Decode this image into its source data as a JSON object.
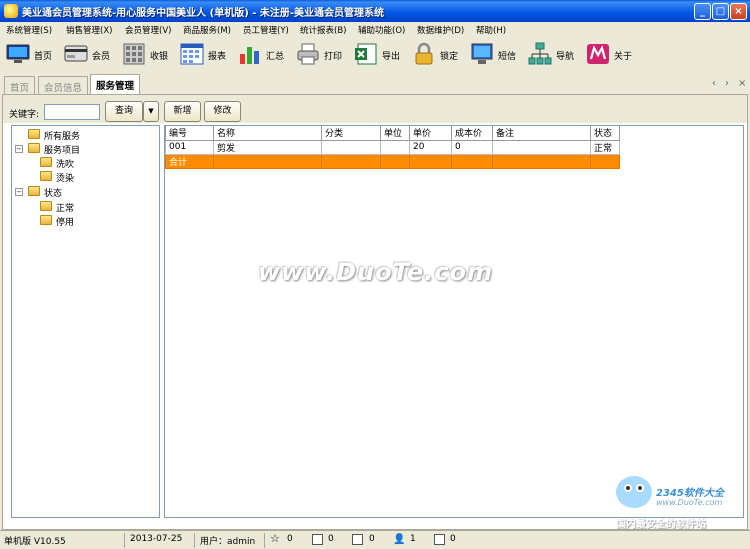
{
  "window": {
    "title": "美业通会员管理系统-用心服务中国美业人 (单机版) - 未注册-美业通会员管理系统"
  },
  "menu": [
    "系统管理(S)",
    "销售管理(X)",
    "会员管理(V)",
    "商品服务(M)",
    "员工管理(Y)",
    "统计报表(B)",
    "辅助功能(O)",
    "数据维护(D)",
    "帮助(H)"
  ],
  "toolbar": [
    {
      "label": "首页",
      "icon": "monitor-icon"
    },
    {
      "label": "会员",
      "icon": "member-card-icon"
    },
    {
      "label": "收银",
      "icon": "calculator-icon"
    },
    {
      "label": "报表",
      "icon": "calendar-grid-icon"
    },
    {
      "label": "汇总",
      "icon": "bar-chart-icon"
    },
    {
      "label": "打印",
      "icon": "printer-icon"
    },
    {
      "label": "导出",
      "icon": "excel-icon"
    },
    {
      "label": "锁定",
      "icon": "lock-icon"
    },
    {
      "label": "短信",
      "icon": "sms-monitor-icon"
    },
    {
      "label": "导航",
      "icon": "sitemap-icon"
    },
    {
      "label": "关于",
      "icon": "about-icon"
    }
  ],
  "tabs": [
    {
      "label": "首页"
    },
    {
      "label": "会员信息"
    },
    {
      "label": "服务管理"
    }
  ],
  "tab_nav": {
    "prev": "‹",
    "next": "›",
    "close": "×"
  },
  "search": {
    "label": "关键字:",
    "value": "",
    "query_button": "查询",
    "add_button": "新增",
    "edit_button": "修改"
  },
  "tree": {
    "root": "所有服务",
    "groups": [
      {
        "label": "服务项目",
        "expander": "−",
        "children": [
          "洗吹",
          "烫染"
        ]
      },
      {
        "label": "状态",
        "expander": "−",
        "children": [
          "正常",
          "停用"
        ]
      }
    ]
  },
  "table": {
    "columns": [
      "编号",
      "名称",
      "分类",
      "单位",
      "单价",
      "成本价",
      "备注",
      "状态"
    ],
    "rows": [
      [
        "001",
        "剪发",
        "",
        "",
        "20",
        "0",
        "",
        "正常"
      ]
    ],
    "total_label": "合计"
  },
  "status": {
    "version": "单机版 V10.55",
    "date": "2013-07-25",
    "user_label": "用户：admin",
    "counters": [
      {
        "icon": "star-icon",
        "value": "0"
      },
      {
        "icon": "message-icon",
        "value": "0"
      },
      {
        "icon": "monitor-small-icon",
        "value": "0"
      },
      {
        "icon": "user-icon",
        "value": "1"
      },
      {
        "icon": "book-icon",
        "value": "0"
      }
    ]
  },
  "watermarks": {
    "main": "www.DuoTe.com",
    "corner_brand": "2345软件大全",
    "corner_url": "www.DuoTe.com",
    "corner_slogan": "国内最安全的软件站"
  },
  "colors": {
    "title_blue": "#0055E5",
    "total_row": "#FF8C00",
    "chrome": "#ECE9D8"
  }
}
